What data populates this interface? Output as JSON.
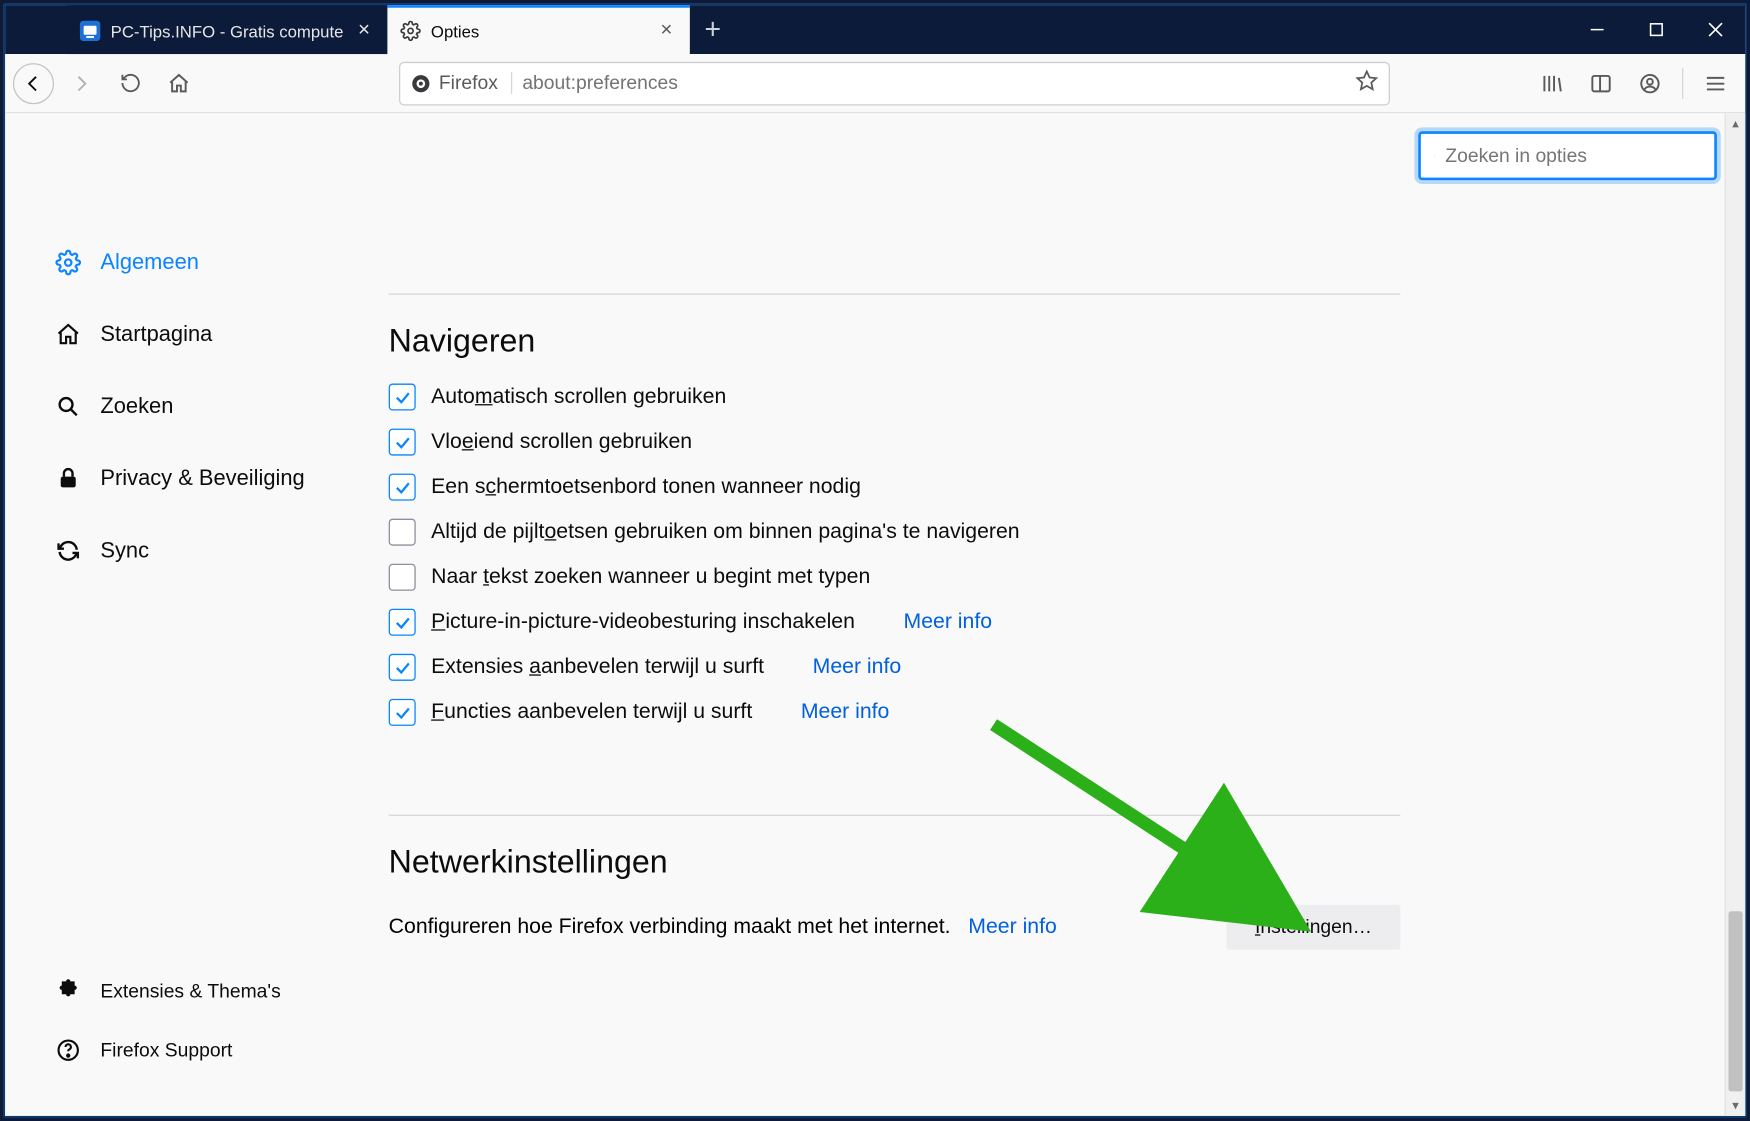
{
  "tabs": [
    {
      "label": "PC-Tips.INFO - Gratis compute",
      "active": false
    },
    {
      "label": "Opties",
      "active": true
    }
  ],
  "urlbar": {
    "identity_label": "Firefox",
    "url": "about:preferences"
  },
  "search": {
    "placeholder": "Zoeken in opties"
  },
  "sidebar": {
    "items": [
      {
        "label": "Algemeen",
        "active": true
      },
      {
        "label": "Startpagina"
      },
      {
        "label": "Zoeken"
      },
      {
        "label": "Privacy & Beveiliging"
      },
      {
        "label": "Sync"
      }
    ],
    "footer": [
      {
        "label": "Extensies & Thema's"
      },
      {
        "label": "Firefox Support"
      }
    ]
  },
  "sections": {
    "browsing": {
      "title": "Navigeren",
      "options": [
        {
          "checked": true,
          "pre": "Auto",
          "ak": "m",
          "post": "atisch scrollen gebruiken"
        },
        {
          "checked": true,
          "pre": "Vlo",
          "ak": "e",
          "post": "iend scrollen gebruiken"
        },
        {
          "checked": true,
          "pre": "Een s",
          "ak": "c",
          "post": "hermtoetsenbord tonen wanneer nodig"
        },
        {
          "checked": false,
          "pre": "Altijd de pijlt",
          "ak": "o",
          "post": "etsen gebruiken om binnen pagina's te navigeren"
        },
        {
          "checked": false,
          "pre": "Naar ",
          "ak": "t",
          "post": "ekst zoeken wanneer u begint met typen"
        },
        {
          "checked": true,
          "pre": "",
          "ak": "P",
          "post": "icture-in-picture-videobesturing inschakelen",
          "link": "Meer info"
        },
        {
          "checked": true,
          "pre": "Extensies ",
          "ak": "a",
          "post": "anbevelen terwijl u surft",
          "link": "Meer info"
        },
        {
          "checked": true,
          "pre": "",
          "ak": "F",
          "post": "uncties aanbevelen terwijl u surft",
          "link": "Meer info"
        }
      ]
    },
    "network": {
      "title": "Netwerkinstellingen",
      "desc": "Configureren hoe Firefox verbinding maakt met het internet.",
      "desc_link": "Meer info",
      "button_pre": "",
      "button_ak": "I",
      "button_post": "nstellingen…"
    }
  }
}
